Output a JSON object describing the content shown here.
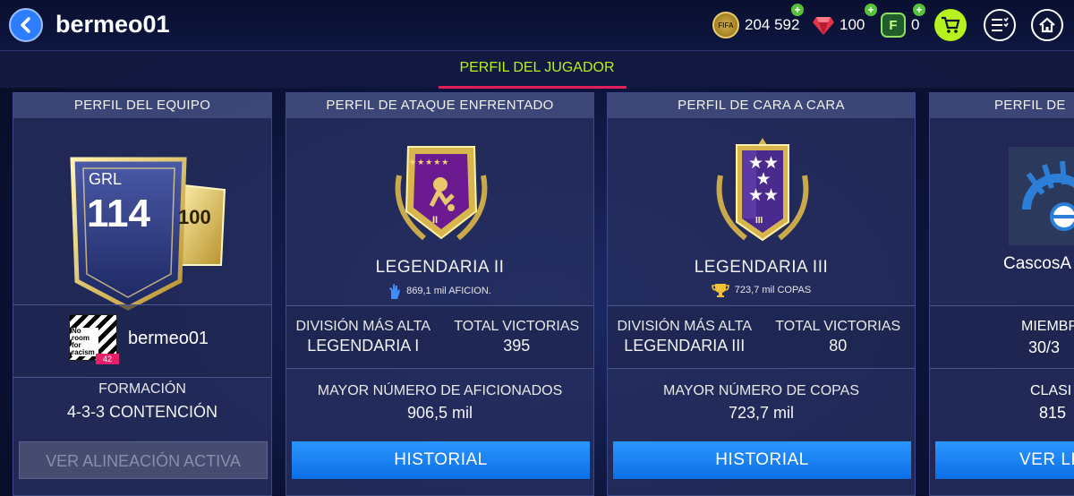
{
  "header": {
    "username": "bermeo01",
    "currencies": {
      "coins": {
        "icon": "fifa-coin-icon",
        "label": "FIFA",
        "value": "204 592"
      },
      "gems": {
        "icon": "fifa-points-gem-icon",
        "value": "100"
      },
      "fpoints": {
        "icon": "f-points-icon",
        "label": "F",
        "value": "0"
      }
    },
    "accent": "#b7f21f"
  },
  "tabs": {
    "active": "PERFIL DEL JUGADOR"
  },
  "team_panel": {
    "title": "PERFIL DEL EQUIPO",
    "grl_label": "GRL",
    "grl_value": "114",
    "chem_value": "100",
    "club_badge_text": "No room for racism",
    "club_badge_level": "42",
    "club_name": "bermeo01",
    "formation_label": "FORMACIÓN",
    "formation_value": "4-3-3 CONTENCIÓN",
    "button_label": "VER ALINEACIÓN ACTIVA"
  },
  "attack_panel": {
    "title": "PERFIL DE ATAQUE ENFRENTADO",
    "rank": "LEGENDARIA II",
    "rank_numeral": "II",
    "fans": "869,1 mil AFICION.",
    "highest_div_label": "DIVISIÓN MÁS ALTA",
    "highest_div_value": "LEGENDARIA I",
    "total_wins_label": "TOTAL VICTORIAS",
    "total_wins_value": "395",
    "max_label": "MAYOR NÚMERO DE AFICIONADOS",
    "max_value": "906,5 mil",
    "button_label": "HISTORIAL"
  },
  "h2h_panel": {
    "title": "PERFIL DE CARA A CARA",
    "rank": "LEGENDARIA III",
    "rank_numeral": "III",
    "cups": "723,7 mil COPAS",
    "highest_div_label": "DIVISIÓN MÁS ALTA",
    "highest_div_value": "LEGENDARIA III",
    "total_wins_label": "TOTAL VICTORIAS",
    "total_wins_value": "80",
    "max_label": "MAYOR NÚMERO DE COPAS",
    "max_value": "723,7 mil",
    "button_label": "HISTORIAL"
  },
  "league_panel": {
    "title": "PERFIL DE",
    "league_name": "CascosA",
    "members_label": "MIEMBR",
    "members_value": "30/3",
    "rank_label": "CLASI",
    "rank_value": "815",
    "button_label": "VER LI"
  }
}
